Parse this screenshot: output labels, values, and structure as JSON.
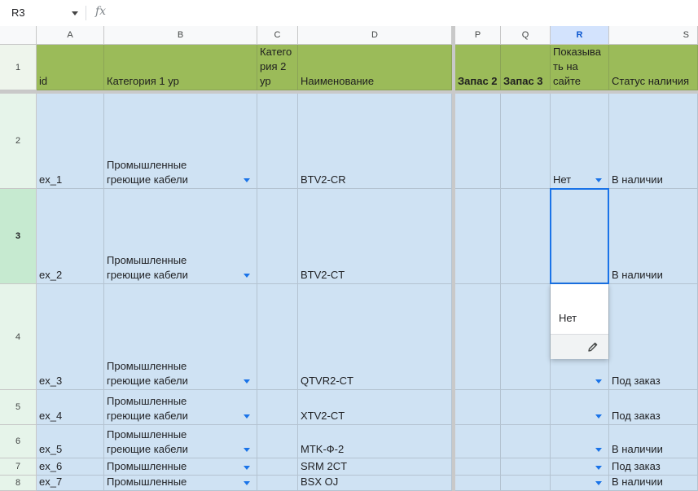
{
  "formula_bar": {
    "cell_ref": "R3",
    "fx_label": "fx",
    "content": ""
  },
  "columns": [
    {
      "letter": "A",
      "header": "id",
      "bold": false
    },
    {
      "letter": "B",
      "header": "Категория 1 ур",
      "bold": false
    },
    {
      "letter": "C",
      "header": "Категория 2 ур",
      "bold": false
    },
    {
      "letter": "D",
      "header": "Наименование",
      "bold": false
    },
    {
      "letter": "P",
      "header": "Запас 2",
      "bold": true
    },
    {
      "letter": "Q",
      "header": "Запас 3",
      "bold": true
    },
    {
      "letter": "R",
      "header": "Показывать на сайте",
      "bold": false
    },
    {
      "letter": "S",
      "header": "Статус наличия",
      "bold": false
    }
  ],
  "header_row": {
    "row_number": "1",
    "cells": {
      "A": "id",
      "B": "Категория 1 ур",
      "C": "Катего\nрия 2\nур",
      "D": "Наименование",
      "P": "Запас 2",
      "Q": "Запас 3",
      "R": "Показыва\nть на\nсайте",
      "S": "Статус наличия"
    }
  },
  "rows": [
    {
      "row_number": "2",
      "id": "ex_1",
      "cat1": "Промышленные\nгреющие кабели",
      "cat2": "",
      "name": "BTV2-CR",
      "zapas2": "",
      "zapas3": "",
      "show": "Нет",
      "status": "В наличии"
    },
    {
      "row_number": "3",
      "id": "ex_2",
      "cat1": "Промышленные\nгреющие кабели",
      "cat2": "",
      "name": "BTV2-CT",
      "zapas2": "",
      "zapas3": "",
      "show": "",
      "status": "В наличии"
    },
    {
      "row_number": "4",
      "id": "ex_3",
      "cat1": "Промышленные\nгреющие кабели",
      "cat2": "",
      "name": "QTVR2-CT",
      "zapas2": "",
      "zapas3": "",
      "show": "",
      "status": "Под заказ"
    },
    {
      "row_number": "5",
      "id": "ex_4",
      "cat1": "Промышленные\nгреющие кабели",
      "cat2": "",
      "name": "XTV2-CT",
      "zapas2": "",
      "zapas3": "",
      "show": "",
      "status": "Под заказ"
    },
    {
      "row_number": "6",
      "id": "ex_5",
      "cat1": "Промышленные\nгреющие кабели",
      "cat2": "",
      "name": "MTK-Ф-2",
      "zapas2": "",
      "zapas3": "",
      "show": "",
      "status": "В наличии"
    },
    {
      "row_number": "7",
      "id": "ex_6",
      "cat1": "Промышленные",
      "cat2": "",
      "name": "SRM 2CT",
      "zapas2": "",
      "zapas3": "",
      "show": "",
      "status": "Под заказ"
    },
    {
      "row_number": "8",
      "id": "ex_7",
      "cat1": "Промышленные",
      "cat2": "",
      "name": "BSX OJ",
      "zapas2": "",
      "zapas3": "",
      "show": "",
      "status": "В наличии"
    }
  ],
  "dropdown_popup": {
    "options": [
      "Нет"
    ],
    "edit_icon": "pencil-icon"
  },
  "colors": {
    "header_green": "#9bbb59",
    "row_blue": "#cfe2f3",
    "selection": "#1a73e8",
    "dropdown_arrow": "#1a73e8"
  }
}
